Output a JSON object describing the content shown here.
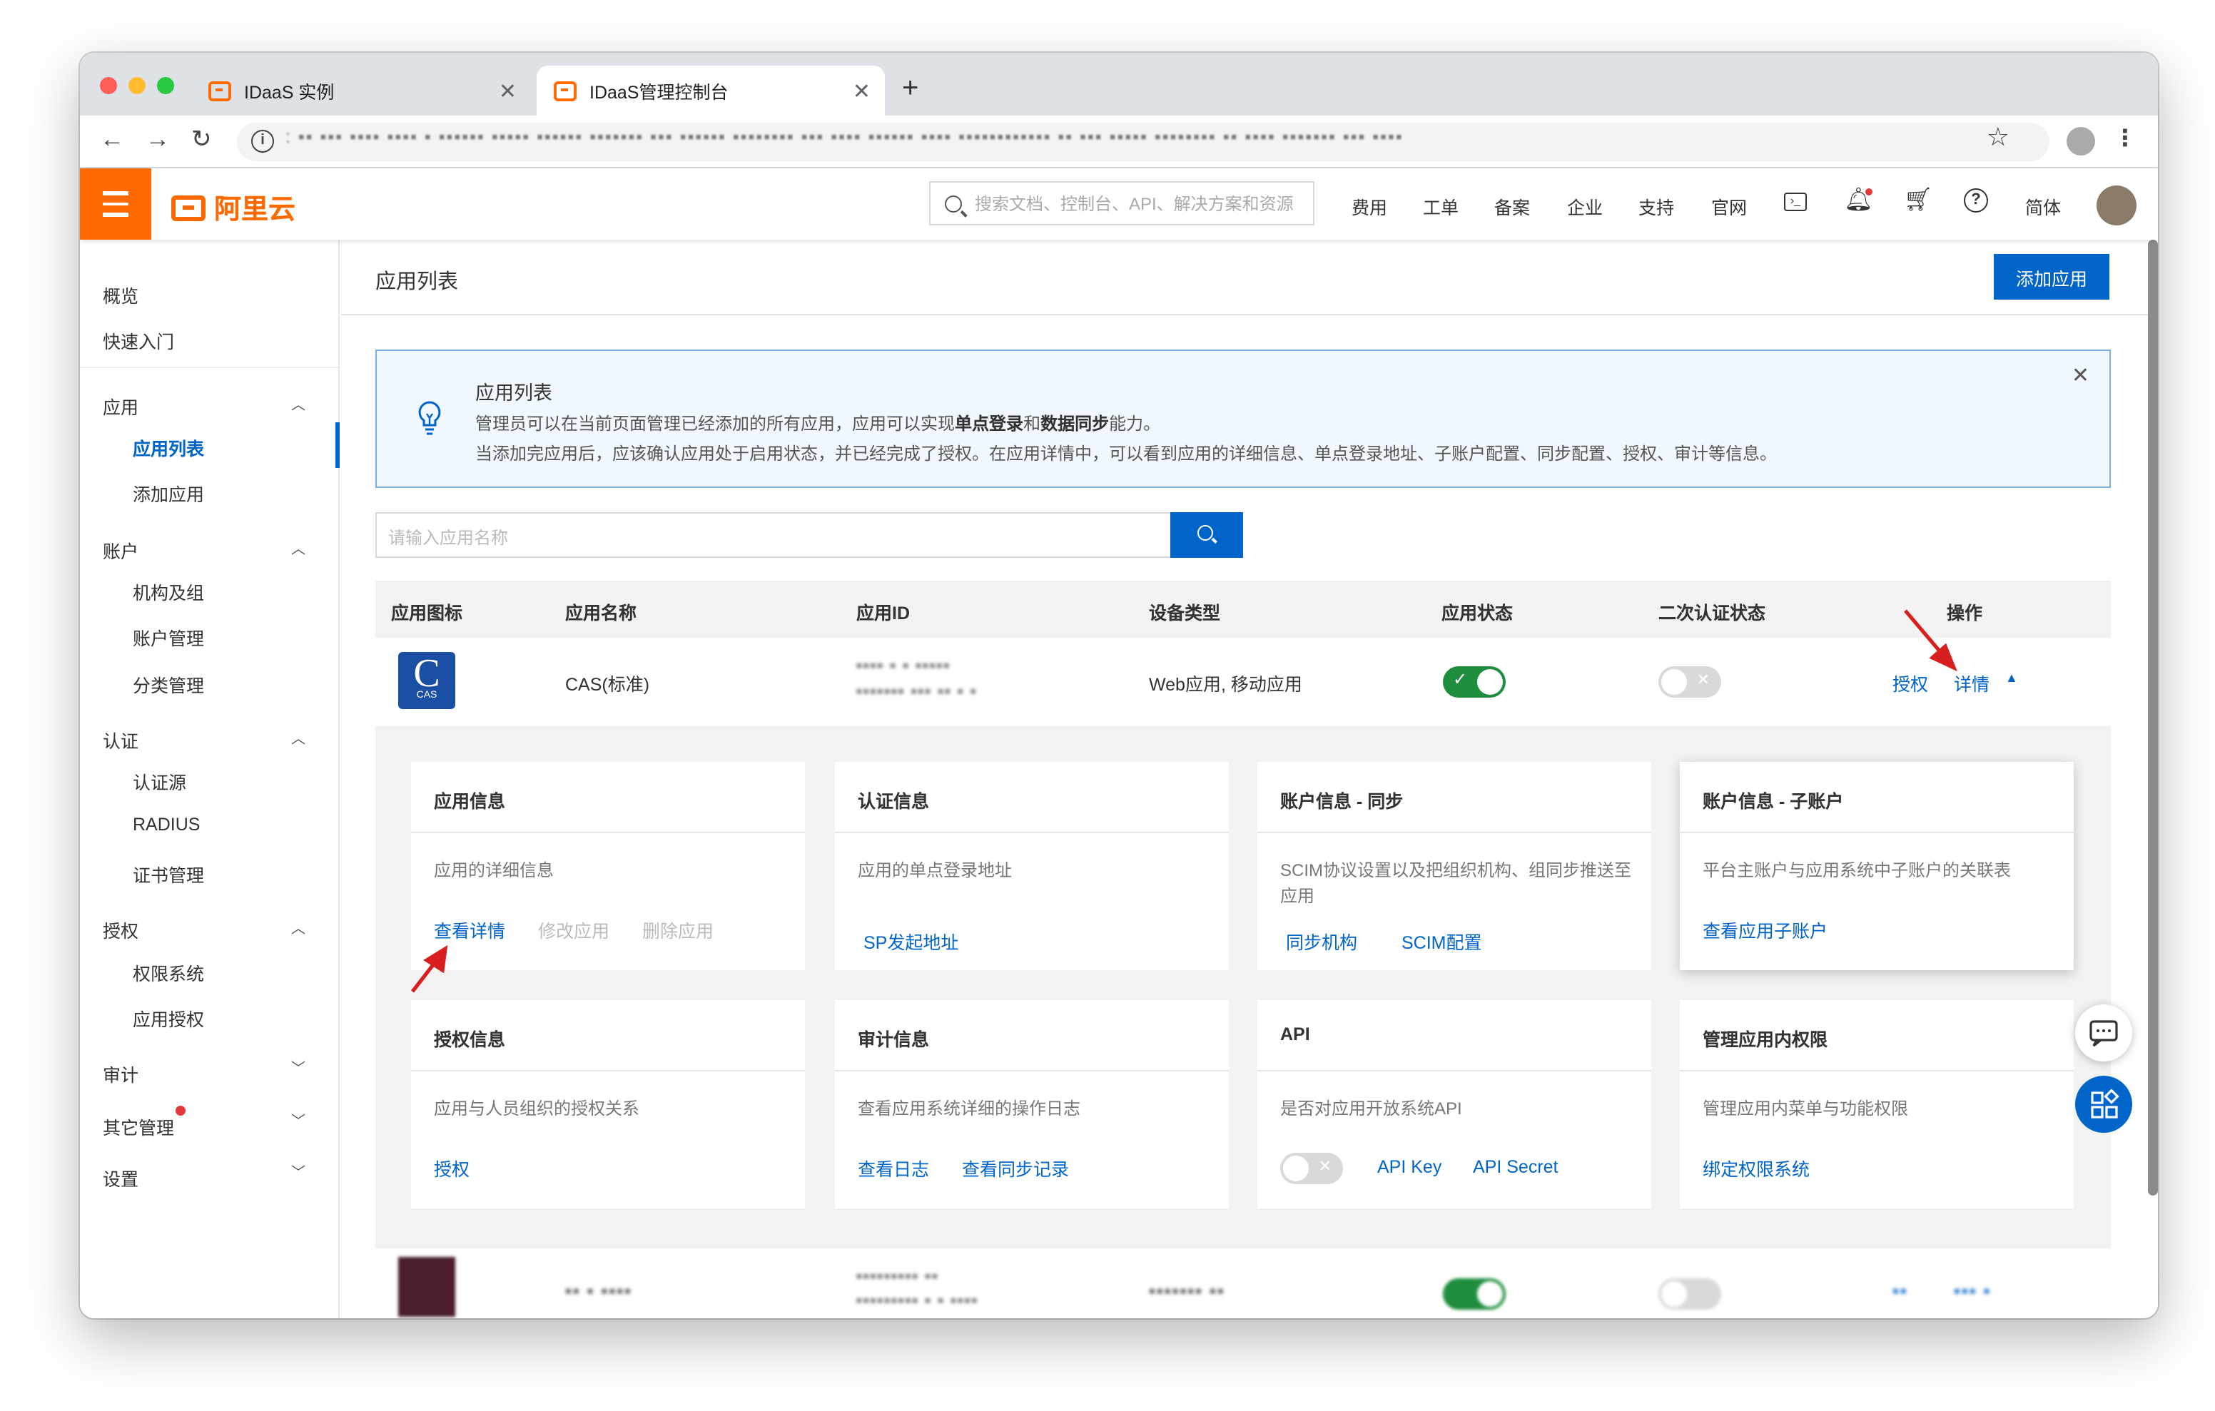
{
  "browser": {
    "tabs": [
      {
        "label": "IDaaS 实例"
      },
      {
        "label": "IDaaS管理控制台"
      }
    ],
    "new_tab": "+",
    "url": ": ▪▪ ▪▪▪ ▪▪▪▪  ▪▪▪▪ ▪ ▪▪▪▪▪▪ ▪▪▪▪▪ ▪▪▪▪▪▪ ▪▪▪▪▪▪▪ ▪▪▪ ▪▪▪▪▪▪ ▪▪▪▪▪▪▪▪ ▪▪▪ ▪▪▪▪ ▪▪▪▪▪▪ ▪▪▪▪ ▪▪▪▪▪▪▪▪▪▪▪▪ ▪▪ ▪▪▪ ▪▪▪▪▪ ▪▪▪▪▪▪▪▪ ▪▪ ▪▪▪▪ ▪▪▪▪▪▪▪ ▪▪▪ ▪▪▪▪"
  },
  "topbar": {
    "logo": "阿里云",
    "search_placeholder": "搜索文档、控制台、API、解决方案和资源",
    "nav": [
      "费用",
      "工单",
      "备案",
      "企业",
      "支持",
      "官网"
    ],
    "lang": "简体"
  },
  "sidebar": {
    "overview": "概览",
    "quickstart": "快速入门",
    "groups": [
      {
        "label": "应用",
        "items": [
          "应用列表",
          "添加应用"
        ]
      },
      {
        "label": "账户",
        "items": [
          "机构及组",
          "账户管理",
          "分类管理"
        ]
      },
      {
        "label": "认证",
        "items": [
          "认证源",
          "RADIUS",
          "证书管理"
        ]
      },
      {
        "label": "授权",
        "items": [
          "权限系统",
          "应用授权"
        ]
      },
      {
        "label": "审计",
        "items": []
      },
      {
        "label": "其它管理",
        "items": []
      },
      {
        "label": "设置",
        "items": []
      }
    ]
  },
  "page": {
    "title": "应用列表",
    "add_button": "添加应用",
    "tip": {
      "title": "应用列表",
      "line1_pre": "管理员可以在当前页面管理已经添加的所有应用，应用可以实现",
      "line1_b1": "单点登录",
      "line1_mid": "和",
      "line1_b2": "数据同步",
      "line1_post": "能力。",
      "line2": "当添加完应用后，应该确认应用处于启用状态，并已经完成了授权。在应用详情中，可以看到应用的详细信息、单点登录地址、子账户配置、同步配置、授权、审计等信息。"
    },
    "search_placeholder": "请输入应用名称",
    "columns": [
      "应用图标",
      "应用名称",
      "应用ID",
      "设备类型",
      "应用状态",
      "二次认证状态",
      "操作"
    ],
    "rows": [
      {
        "icon_text": "C",
        "icon_sub": "CAS",
        "name": "CAS(标准)",
        "id_line1": "▪▪▪▪ ▪ ▪ ▪▪▪▪▪",
        "id_line2": "▪▪▪▪▪▪▪  ▪▪▪ ▪▪   ▪ ▪",
        "device": "Web应用, 移动应用",
        "status_on": true,
        "mfa_on": false,
        "action_auth": "授权",
        "action_detail": "详情"
      },
      {
        "name": "▪▪ ▪ ▪▪▪▪",
        "id_line1": "▪▪▪▪▪▪▪▪▪ ▪▪",
        "id_line2": "▪▪▪▪▪▪▪▪▪ ▪ ▪ ▪▪▪▪",
        "device": "▪▪▪▪▪▪▪ ▪▪",
        "action_auth": "▪▪ ",
        "action_detail": "▪▪▪ ▪"
      }
    ],
    "cards": [
      {
        "title": "应用信息",
        "desc": "应用的详细信息",
        "links": [
          "查看详情"
        ],
        "disabled": [
          "修改应用",
          "删除应用"
        ]
      },
      {
        "title": "认证信息",
        "desc": "应用的单点登录地址",
        "links": [
          "SP发起地址"
        ]
      },
      {
        "title": "账户信息 - 同步",
        "desc": "SCIM协议设置以及把组织机构、组同步推送至应用",
        "links": [
          "同步机构",
          "SCIM配置"
        ]
      },
      {
        "title": "账户信息 - 子账户",
        "desc": "平台主账户与应用系统中子账户的关联表",
        "links": [
          "查看应用子账户"
        ]
      },
      {
        "title": "授权信息",
        "desc": "应用与人员组织的授权关系",
        "links": [
          "授权"
        ]
      },
      {
        "title": "审计信息",
        "desc": "查看应用系统详细的操作日志",
        "links": [
          "查看日志",
          "查看同步记录"
        ]
      },
      {
        "title": "API",
        "desc": "是否对应用开放系统API",
        "links": [
          "API Key",
          "API Secret"
        ],
        "toggle_on": false
      },
      {
        "title": "管理应用内权限",
        "desc": "管理应用内菜单与功能权限",
        "links": [
          "绑定权限系统"
        ]
      }
    ]
  },
  "colors": {
    "accent": "#0064c8",
    "brand": "#ff6a00",
    "toggle_on": "#1e8e3e",
    "annotation_arrow": "#d81e1e"
  },
  "icons": [
    "info-icon",
    "star-icon",
    "bell-icon",
    "cart-icon",
    "help-icon",
    "terminal-icon",
    "lightbulb-icon",
    "chat-icon",
    "apps-icon"
  ]
}
